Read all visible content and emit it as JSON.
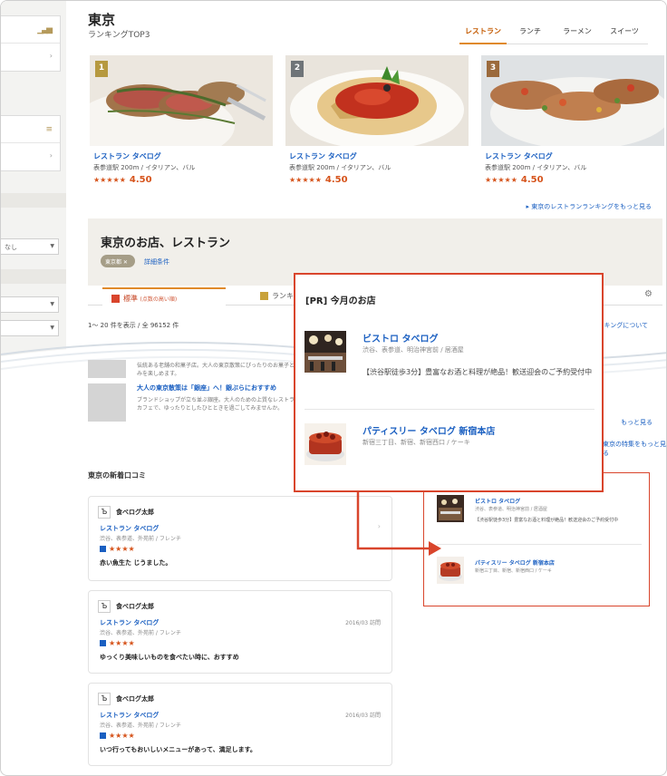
{
  "area_title": "東京",
  "ranking_subtitle": "ランキングTOP3",
  "tabs": [
    {
      "label": "レストラン",
      "active": true
    },
    {
      "label": "ランチ",
      "active": false
    },
    {
      "label": "ラーメン",
      "active": false
    },
    {
      "label": "スイーツ",
      "active": false
    }
  ],
  "ranking": [
    {
      "rank": "1",
      "name": "レストラン タベログ",
      "meta": "表参道駅 200m / イタリアン、バル",
      "stars": "★★★★★",
      "score": "4.50"
    },
    {
      "rank": "2",
      "name": "レストラン タベログ",
      "meta": "表参道駅 200m / イタリアン、バル",
      "stars": "★★★★★",
      "score": "4.50"
    },
    {
      "rank": "3",
      "name": "レストラン タベログ",
      "meta": "表参道駅 200m / イタリアン、バル",
      "stars": "★★★★★",
      "score": "4.50"
    }
  ],
  "more_ranking_link": "▸ 東京のレストランランキングをもっと見る",
  "shop_section": {
    "title": "東京のお店、レストラン",
    "filter_pill": "東京都 ✕",
    "detail_link": "詳細条件"
  },
  "list_tabs": {
    "tab1_label": "標準",
    "tab1_note": "(点数の高い順)",
    "tab2_label": "ランキング"
  },
  "result_count": "1～ 20 件を表示 / 全 96152 件",
  "about_link": "ランキングについて",
  "lower_rows": [
    {
      "title": "",
      "text": "伝統ある老舗の和菓子店。大人の東京散策にぴったりのお菓子と街並みを楽しめます。"
    },
    {
      "title": "大人の東京散策は「銀座」へ！銀ぶらにおすすめ",
      "text": "ブランドショップが立ち並ぶ銀座。大人のための上質なレストランやカフェで、ゆったりとしたひとときを過ごしてみませんか。"
    }
  ],
  "more_link_right": "もっと見る",
  "more_link_bottom": "東京の特集をもっと見る",
  "reviews_heading": "東京の新着口コミ",
  "reviews": [
    {
      "user": "食べログ太郎",
      "shop": "レストラン タベログ",
      "area": "渋谷、表参道、外苑前 / フレンチ",
      "date": "",
      "stars": "★★★★",
      "text": "赤い魚生た じうました。"
    },
    {
      "user": "食べログ太郎",
      "shop": "レストラン タベログ",
      "area": "渋谷、表参道、外苑前 / フレンチ",
      "date": "2016/03 訪問",
      "stars": "★★★★",
      "text": "ゆっくり美味しいものを食べたい時に、おすすめ"
    },
    {
      "user": "食べログ太郎",
      "shop": "レストラン タベログ",
      "area": "渋谷、表参道、外苑前 / フレンチ",
      "date": "2016/03 訪問",
      "stars": "★★★★",
      "text": "いつ行ってもおいしいメニューがあって、満足します。"
    }
  ],
  "pr": {
    "title": "[PR] 今月のお店",
    "items": [
      {
        "name": "ビストロ タベログ",
        "meta": "渋谷、表参道、明治神宮前 / 居酒屋",
        "desc": "【渋谷駅徒歩3分】豊富なお酒と料理が絶品！歓送迎会のご予約受付中"
      },
      {
        "name": "パティスリー タベログ 新宿本店",
        "meta": "新宿三丁目、新宿、新宿西口 / ケーキ",
        "desc": ""
      }
    ]
  },
  "pr_small": {
    "items": [
      {
        "name": "ビストロ タベログ",
        "meta": "渋谷、表参道、明治神宮前 / 居酒屋",
        "desc": "【渋谷駅徒歩3分】豊富なお酒と料理が絶品！歓送迎会のご予約受付中"
      },
      {
        "name": "パティスリー タベログ 新宿本店",
        "meta": "新宿三丁目、新宿、新宿西口 / ケーキ",
        "desc": ""
      }
    ]
  },
  "sidebar_select_value": "なし",
  "colors": {
    "accent": "#e08a2a",
    "link": "#1a5fc1",
    "highlight": "#d9452c",
    "star": "#d6541c"
  }
}
